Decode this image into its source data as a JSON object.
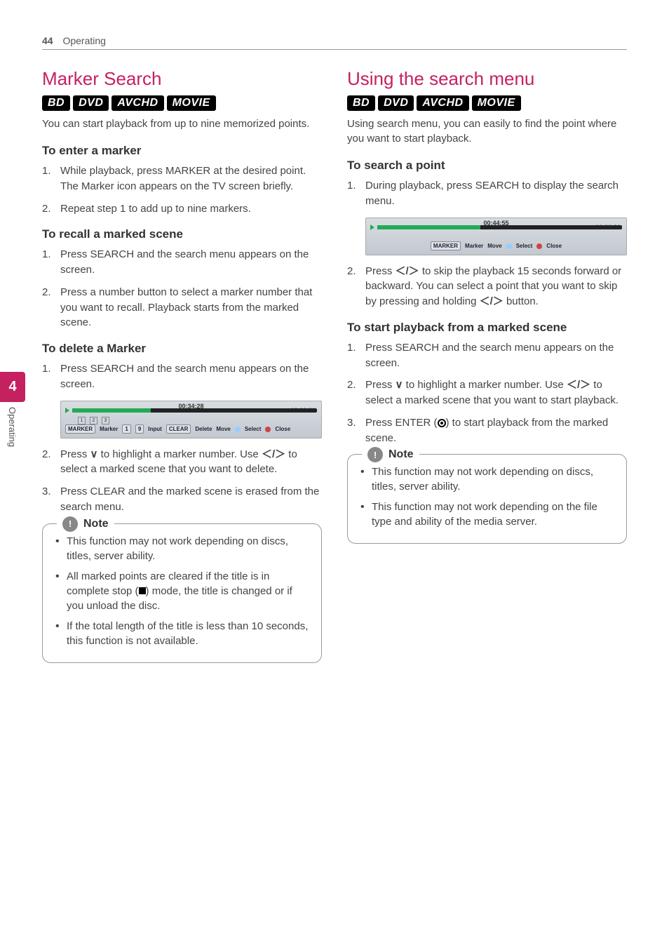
{
  "header": {
    "page_num": "44",
    "section": "Operating"
  },
  "side": {
    "chapter_num": "4",
    "chapter_label": "Operating"
  },
  "left": {
    "title": "Marker Search",
    "formats": [
      "BD",
      "DVD",
      "AVCHD",
      "MOVIE"
    ],
    "intro": "You can start playback from up to nine memorized points.",
    "sub1": {
      "title": "To enter a marker",
      "steps": [
        "While playback, press MARKER at the desired point. The Marker icon appears on the TV screen briefly.",
        "Repeat step 1 to add up to nine markers."
      ]
    },
    "sub2": {
      "title": "To recall a marked scene",
      "steps": [
        "Press SEARCH and the search menu appears on the screen.",
        "Press a number button to select a marker number that you want to recall. Playback starts from the marked scene."
      ]
    },
    "sub3": {
      "title": "To delete a Marker",
      "steps": [
        "Press SEARCH and the search menu appears on the screen.",
        "Press s to highlight a marker number. Use a/d to select a marked scene that you want to delete.",
        "Press CLEAR and the marked scene is erased from the search menu."
      ],
      "step2_parts": {
        "a": "Press ",
        "b": " to highlight a marker number. Use ",
        "c": " to select a marked scene that you want to delete."
      }
    },
    "screenshot1": {
      "time_elapsed": "00:34:28",
      "time_total": "01:36:36",
      "markers": [
        "1",
        "2",
        "3"
      ],
      "buttons": [
        "MARKER",
        "Marker",
        "1",
        "9",
        "Input",
        "CLEAR",
        "Delete",
        "Move",
        "Select",
        "Close"
      ]
    },
    "note": {
      "label": "Note",
      "items": [
        "This function may not work depending on discs, titles, server ability.",
        "All marked points are cleared if the title is in complete stop (Z) mode, the title is changed or if you unload the disc.",
        "If the total length of the title is less than 10 seconds, this function is not available."
      ],
      "item2_parts": {
        "a": "All marked points are cleared if the title is in complete stop (",
        "b": ") mode, the title is changed or if you unload the disc."
      }
    }
  },
  "right": {
    "title": "Using the search menu",
    "formats": [
      "BD",
      "DVD",
      "AVCHD",
      "MOVIE"
    ],
    "intro": "Using search menu, you can easily to find the point where you want to start playback.",
    "sub1": {
      "title": "To search a point",
      "steps": [
        "During playback, press SEARCH to display the search menu.",
        "Press a/d to skip the playback 15 seconds forward or backward. You can select a point that you want to skip by pressing and holding a/d button."
      ],
      "step2_parts": {
        "a": "Press ",
        "b": " to skip the playback 15 seconds forward or backward. You can select a point that you want to skip by pressing and holding ",
        "c": " button."
      }
    },
    "screenshot2": {
      "time_elapsed": "00:44:55",
      "time_total": "01:36:36",
      "buttons": [
        "MARKER",
        "Marker",
        "Move",
        "Select",
        "Close"
      ]
    },
    "sub2": {
      "title": "To start playback from a marked scene",
      "steps": [
        "Press SEARCH and the search menu appears on the screen.",
        "Press s to highlight a marker number. Use a/d to select a marked scene that you want to start playback.",
        "Press ENTER (b) to start playback from the marked scene."
      ],
      "step2_parts": {
        "a": "Press ",
        "b": " to highlight a marker number. Use ",
        "c": " to select a marked scene that you want to start playback."
      },
      "step3_parts": {
        "a": "Press ENTER (",
        "b": ") to start playback from the marked scene."
      }
    },
    "note": {
      "label": "Note",
      "items": [
        "This function may not work depending on discs, titles, server ability.",
        "This function may not work depending on the file type and ability of the media server."
      ]
    }
  }
}
